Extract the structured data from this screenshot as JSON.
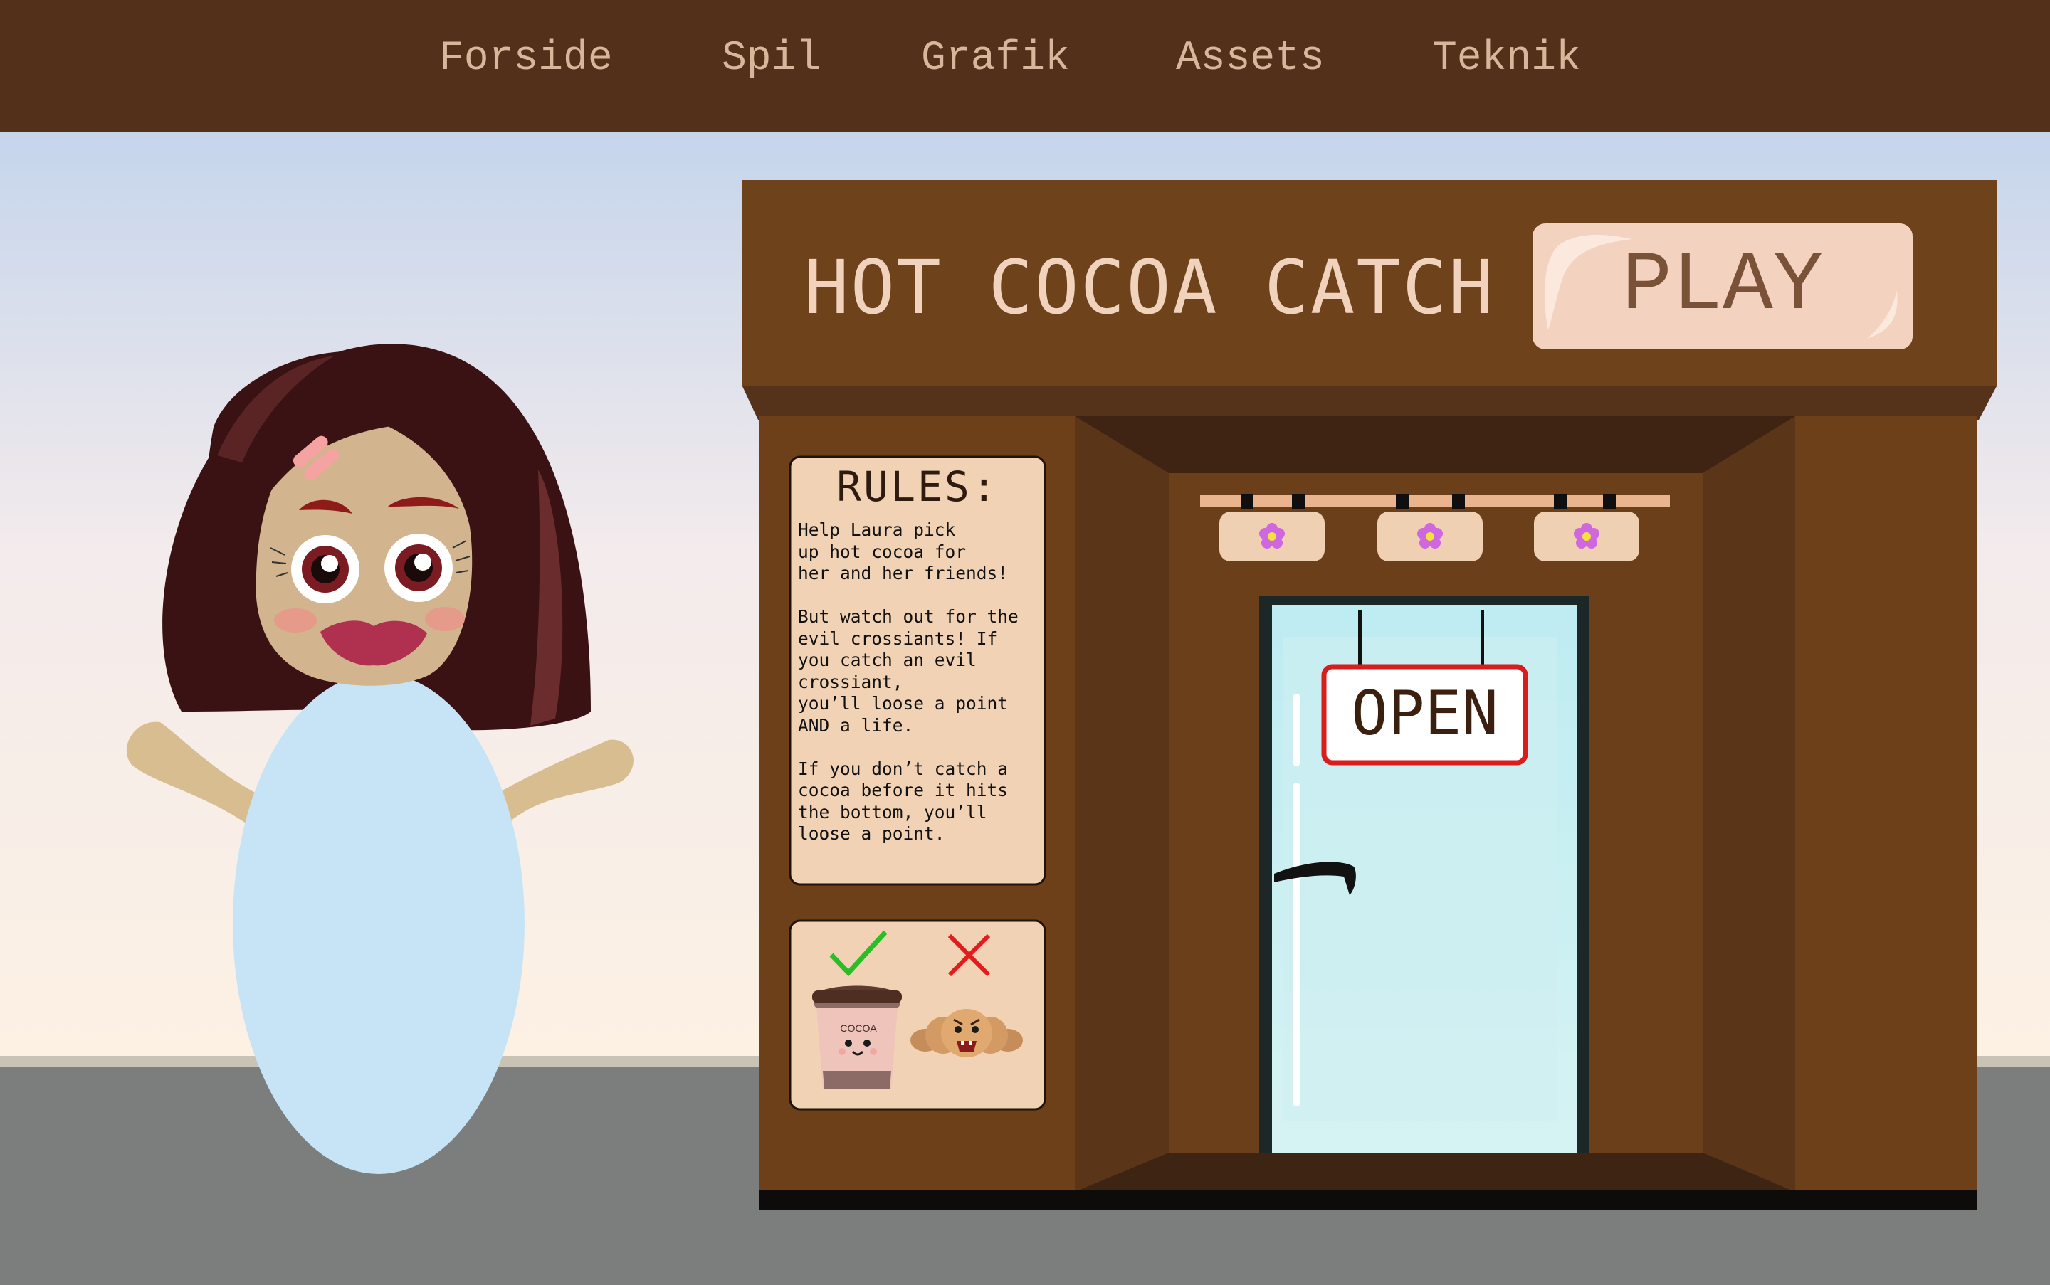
{
  "nav": {
    "items": [
      {
        "label": "Forside"
      },
      {
        "label": "Spil"
      },
      {
        "label": "Grafik"
      },
      {
        "label": "Assets"
      },
      {
        "label": "Teknik"
      }
    ]
  },
  "game": {
    "title": "HOT COCOA CATCH",
    "play_label": "PLAY",
    "rules_heading": "RULES:",
    "rules_text": "Help Laura pick\nup hot cocoa for\nher and her friends!\n\nBut watch out for the\nevil crossiants! If\nyou catch an evil\ncrossiant,\nyou’ll loose a point\nAND a life.\n\nIf you don’t catch a\ncocoa before it hits\nthe bottom, you’ll\nloose a point.",
    "open_sign": "OPEN",
    "cup_label": "COCOA"
  },
  "legend": {
    "catch_icon": "check-mark",
    "avoid_icon": "x-mark",
    "catch_item": "cocoa-cup",
    "avoid_item": "evil-croissant"
  },
  "colors": {
    "nav_bg": "#53301a",
    "nav_text": "#d7b79b",
    "shop_wood": "#6e421b",
    "play_button": "#f3d3bf",
    "rules_card": "#f1d2b4",
    "check": "#2bbd25",
    "cross": "#e01c1c",
    "open_sign_border": "#d91c1c",
    "dress": "#c7e4f6",
    "hair": "#3a1213"
  }
}
